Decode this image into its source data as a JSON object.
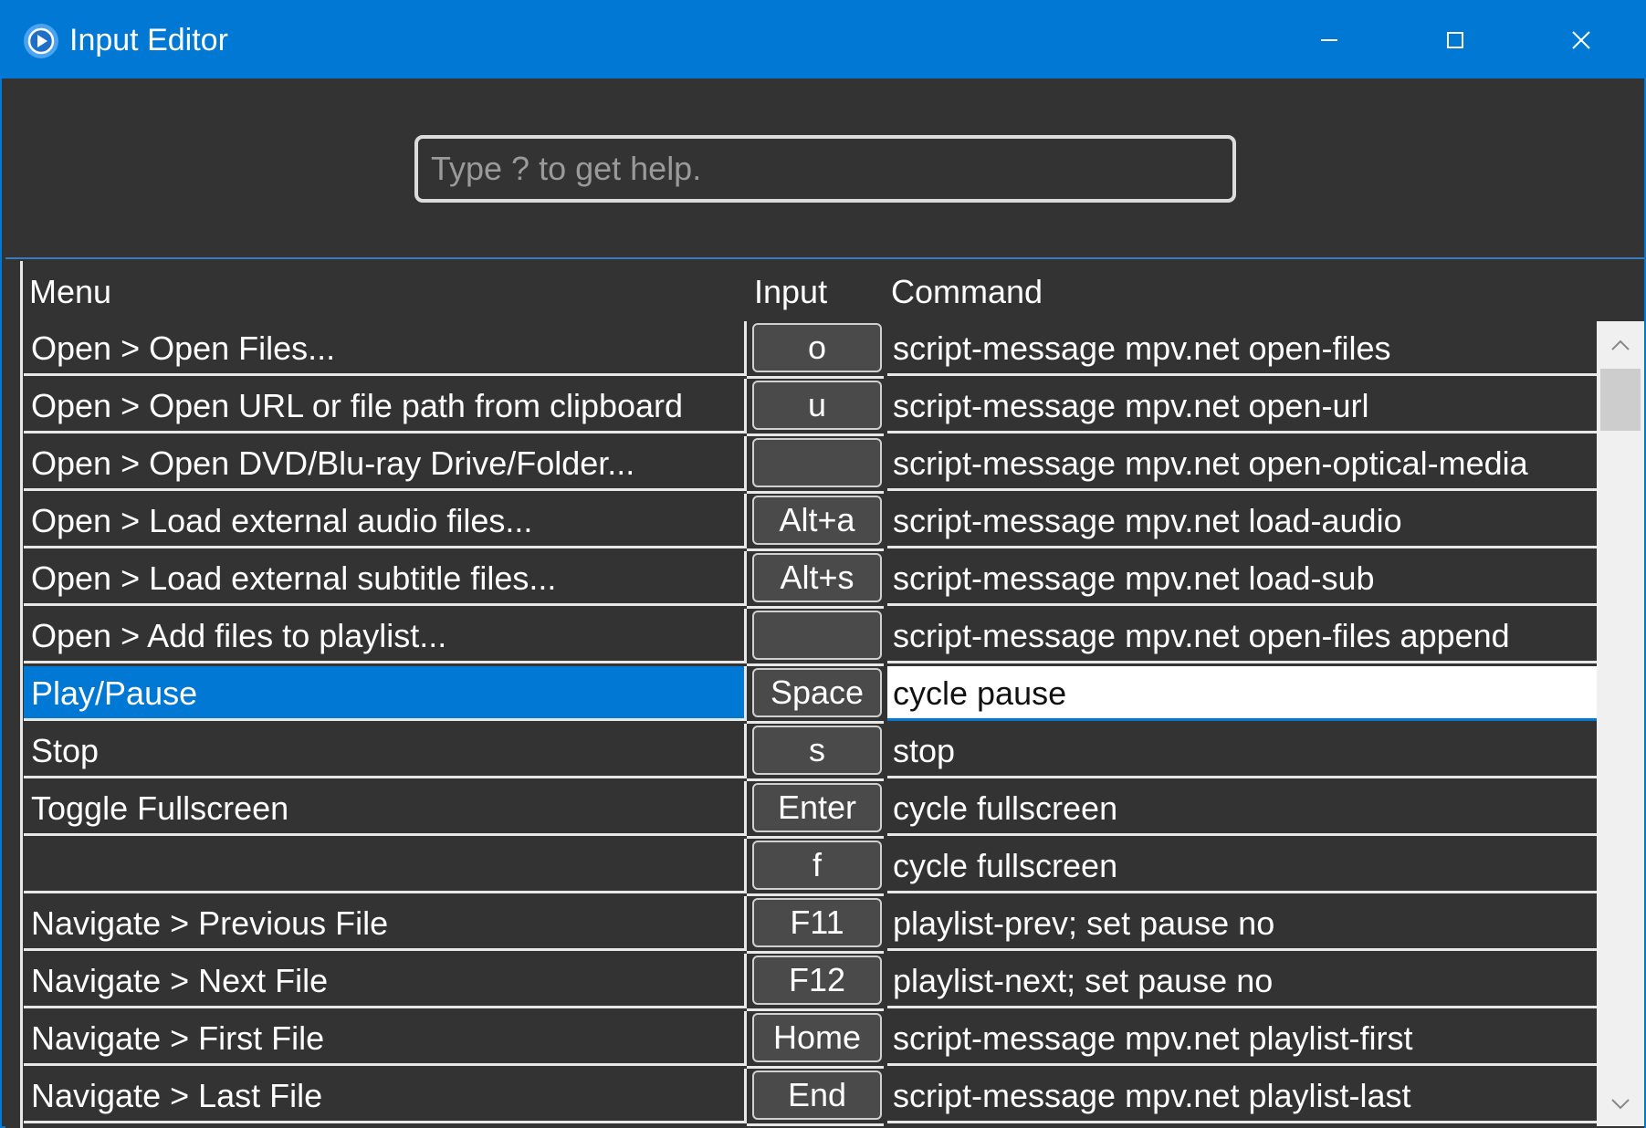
{
  "window": {
    "title": "Input Editor",
    "accent_color": "#0078d4",
    "icons": {
      "app": "mpv-play-icon",
      "minimize": "minimize-icon",
      "maximize": "maximize-icon",
      "close": "close-icon"
    }
  },
  "search": {
    "value": "",
    "placeholder": "Type ? to get help."
  },
  "grid": {
    "columns": {
      "menu": "Menu",
      "input": "Input",
      "command": "Command"
    },
    "rows": [
      {
        "menu": "Open > Open Files...",
        "input": "o",
        "command": "script-message mpv.net open-files"
      },
      {
        "menu": "Open > Open URL or file path from clipboard",
        "input": "u",
        "command": "script-message mpv.net open-url"
      },
      {
        "menu": "Open > Open DVD/Blu-ray Drive/Folder...",
        "input": "",
        "command": "script-message mpv.net open-optical-media"
      },
      {
        "menu": "Open > Load external audio files...",
        "input": "Alt+a",
        "command": "script-message mpv.net load-audio"
      },
      {
        "menu": "Open > Load external subtitle files...",
        "input": "Alt+s",
        "command": "script-message mpv.net load-sub"
      },
      {
        "menu": "Open > Add files to playlist...",
        "input": "",
        "command": "script-message mpv.net open-files append"
      },
      {
        "menu": "Play/Pause",
        "input": "Space",
        "command": "cycle pause",
        "selected": true
      },
      {
        "menu": "Stop",
        "input": "s",
        "command": "stop"
      },
      {
        "menu": "Toggle Fullscreen",
        "input": "Enter",
        "command": "cycle fullscreen"
      },
      {
        "menu": "",
        "input": "f",
        "command": "cycle fullscreen"
      },
      {
        "menu": "Navigate > Previous File",
        "input": "F11",
        "command": "playlist-prev; set pause no"
      },
      {
        "menu": "Navigate > Next File",
        "input": "F12",
        "command": "playlist-next; set pause no"
      },
      {
        "menu": "Navigate > First File",
        "input": "Home",
        "command": "script-message mpv.net playlist-first"
      },
      {
        "menu": "Navigate > Last File",
        "input": "End",
        "command": "script-message mpv.net playlist-last"
      }
    ]
  }
}
